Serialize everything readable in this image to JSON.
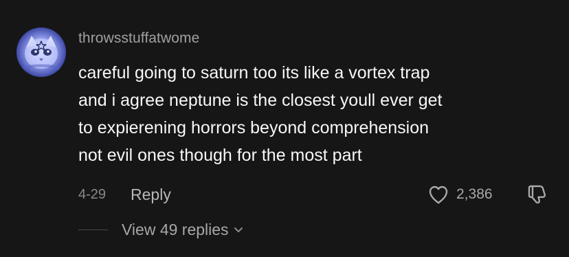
{
  "comment": {
    "username": "throwsstuffatwome",
    "lines": [
      "careful going to saturn too its like a vortex trap",
      "and i agree neptune is the closest youll ever get",
      "to expierening horrors beyond comprehension",
      "not evil ones though for the most part"
    ],
    "date": "4-29",
    "reply_label": "Reply",
    "like_count": "2,386",
    "view_replies_label": "View 49 replies"
  },
  "icons": {
    "like": "heart-icon",
    "dislike": "thumbs-down-icon",
    "expand": "chevron-down-icon"
  },
  "colors": {
    "background": "#161616",
    "text_primary": "#f7f7f7",
    "text_secondary": "#a0a0a0"
  }
}
